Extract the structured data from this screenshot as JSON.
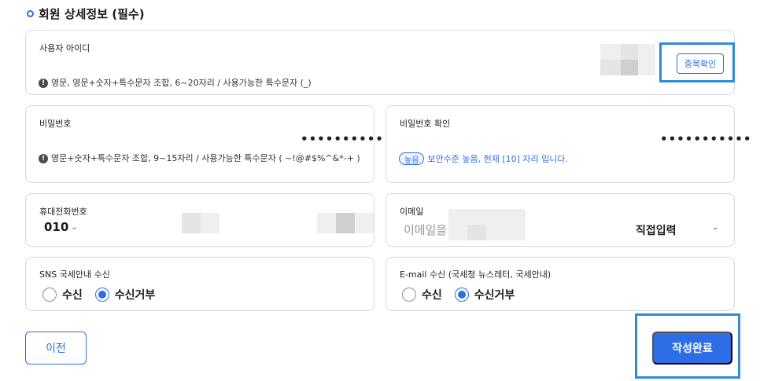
{
  "section": {
    "title": "회원 상세정보 (필수)"
  },
  "user_id": {
    "label": "사용자 아이디",
    "dup_check_label": "중복확인",
    "hint": "영문, 영문+숫자+특수문자 조합, 6~20자리 / 사용가능한 특수문자 (_)"
  },
  "password": {
    "label": "비밀번호",
    "masked": "••••••••••",
    "hint": "영문+숫자+특수문자 조합, 9~15자리 / 사용가능한 특수문자 ( ~!@#$%^&*-+ )"
  },
  "password_confirm": {
    "label": "비밀번호 확인",
    "masked": "•••••••••••",
    "level_badge": "높음",
    "level_text": "보안수준 높음, 현재 [10] 자리 입니다."
  },
  "phone": {
    "label": "휴대전화번호",
    "prefix": "010"
  },
  "email": {
    "label": "이메일",
    "placeholder": "이메일을",
    "domain": "직접입력"
  },
  "sns": {
    "label": "SNS 국세안내 수신",
    "options": [
      {
        "label": "수신",
        "checked": false
      },
      {
        "label": "수신거부",
        "checked": true
      }
    ]
  },
  "email_subscribe": {
    "label": "E-mail 수신 (국세청 뉴스레터, 국세안내)",
    "options": [
      {
        "label": "수신",
        "checked": false
      },
      {
        "label": "수신거부",
        "checked": true
      }
    ]
  },
  "buttons": {
    "prev": "이전",
    "submit": "작성완료"
  },
  "colors": {
    "accent": "#2d6ee6",
    "highlight": "#2f8ad8",
    "border": "#d4d8de"
  },
  "icons": {
    "warning": "exclamation-circle-icon",
    "chevron": "chevron-down-icon",
    "radio": "radio-button-icon"
  }
}
